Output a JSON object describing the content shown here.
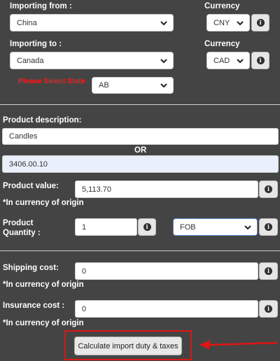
{
  "origin": {
    "label": "Importing from :",
    "country": "China",
    "currency_label": "Currency",
    "currency": "CNY"
  },
  "destination": {
    "label": "Importing to :",
    "country": "Canada",
    "currency_label": "Currency",
    "currency": "CAD",
    "state_label": "Please Select State",
    "state": "AB"
  },
  "product": {
    "description_label": "Product description:",
    "description_value": "Candles",
    "or_label": "OR",
    "hs_code_value": "3406.00.10",
    "value_label": "Product value:",
    "value": "5,113.70",
    "currency_note": "*In currency of origin",
    "quantity_label_line1": "Product",
    "quantity_label_line2": "Quantity :",
    "quantity": "1",
    "incoterm": "FOB"
  },
  "shipping": {
    "label": "Shipping cost:",
    "value": "0",
    "note": "*In currency of origin"
  },
  "insurance": {
    "label": "Insurance cost :",
    "value": "0",
    "note": "*In currency of origin"
  },
  "actions": {
    "calculate_label": "Calculate import duty & taxes"
  },
  "icons": {
    "info": "info-circle-icon",
    "chevron": "chevron-down-icon",
    "arrow": "red-arrow-annotation"
  },
  "colors": {
    "background": "#444444",
    "required_text": "#ff1a1a",
    "annotation": "#e01414"
  }
}
